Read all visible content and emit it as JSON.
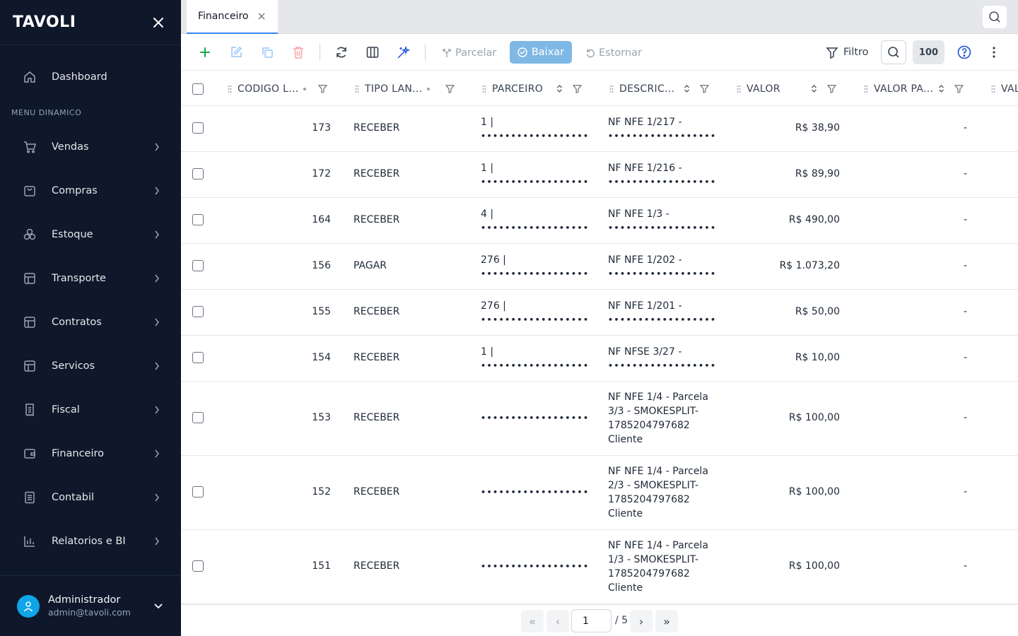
{
  "app": {
    "logo": "TAVOLI"
  },
  "sidebar": {
    "section_label": "MENU DINAMICO",
    "dashboard": {
      "label": "Dashboard",
      "icon": "home-icon"
    },
    "items": [
      {
        "label": "Vendas",
        "icon": "cart-icon"
      },
      {
        "label": "Compras",
        "icon": "shopping-bag-icon"
      },
      {
        "label": "Estoque",
        "icon": "boxes-icon"
      },
      {
        "label": "Transporte",
        "icon": "table-icon"
      },
      {
        "label": "Contratos",
        "icon": "table-icon"
      },
      {
        "label": "Servicos",
        "icon": "table-icon"
      },
      {
        "label": "Fiscal",
        "icon": "receipt-icon"
      },
      {
        "label": "Financeiro",
        "icon": "wallet-icon"
      },
      {
        "label": "Contabil",
        "icon": "ledger-icon"
      },
      {
        "label": "Relatorios e BI",
        "icon": "bar-chart-icon"
      }
    ],
    "user": {
      "name": "Administrador",
      "email": "admin@tavoli.com"
    }
  },
  "tabs": [
    {
      "label": "Financeiro",
      "active": true
    }
  ],
  "toolbar": {
    "parcelar_label": "Parcelar",
    "baixar_label": "Baixar",
    "estornar_label": "Estornar",
    "filtro_label": "Filtro",
    "page_size": "100",
    "accent_color": "#7fb8e4"
  },
  "table": {
    "columns": [
      "CODIGO L...",
      "TIPO LAN...",
      "PARCEIRO",
      "DESCRIC...",
      "VALOR",
      "VALOR PA...",
      "VAL"
    ],
    "rows": [
      {
        "codigo": "173",
        "tipo": "RECEBER",
        "parceiro_line1": "1 |",
        "parceiro_masked": "••••••••••••••••••",
        "descricao_lines": [
          "NF NFE 1/217 -",
          "••••••••••••••••••"
        ],
        "valor": "R$ 38,90",
        "valor_pago": "-"
      },
      {
        "codigo": "172",
        "tipo": "RECEBER",
        "parceiro_line1": "1 |",
        "parceiro_masked": "••••••••••••••••••",
        "descricao_lines": [
          "NF NFE 1/216 -",
          "••••••••••••••••••"
        ],
        "valor": "R$ 89,90",
        "valor_pago": "-"
      },
      {
        "codigo": "164",
        "tipo": "RECEBER",
        "parceiro_line1": "4 |",
        "parceiro_masked": "••••••••••••••••••",
        "descricao_lines": [
          "NF NFE 1/3 -",
          "••••••••••••••••••"
        ],
        "valor": "R$ 490,00",
        "valor_pago": "-"
      },
      {
        "codigo": "156",
        "tipo": "PAGAR",
        "parceiro_line1": "276 |",
        "parceiro_masked": "••••••••••••••••••",
        "descricao_lines": [
          "NF NFE 1/202 -",
          "••••••••••••••••••"
        ],
        "valor": "R$ 1.073,20",
        "valor_pago": "-"
      },
      {
        "codigo": "155",
        "tipo": "RECEBER",
        "parceiro_line1": "276 |",
        "parceiro_masked": "••••••••••••••••••",
        "descricao_lines": [
          "NF NFE 1/201 -",
          "••••••••••••••••••"
        ],
        "valor": "R$ 50,00",
        "valor_pago": "-"
      },
      {
        "codigo": "154",
        "tipo": "RECEBER",
        "parceiro_line1": "1 |",
        "parceiro_masked": "••••••••••••••••••",
        "descricao_lines": [
          "NF NFSE 3/27 -",
          "••••••••••••••••••"
        ],
        "valor": "R$ 10,00",
        "valor_pago": "-"
      },
      {
        "codigo": "153",
        "tipo": "RECEBER",
        "parceiro_line1": "",
        "parceiro_masked": "••••••••••••••••••",
        "descricao_lines": [
          "NF NFE 1/4 - Parcela",
          "3/3 - SMOKESPLIT-",
          "1785204797682",
          "Cliente"
        ],
        "valor": "R$ 100,00",
        "valor_pago": "-"
      },
      {
        "codigo": "152",
        "tipo": "RECEBER",
        "parceiro_line1": "",
        "parceiro_masked": "••••••••••••••••••",
        "descricao_lines": [
          "NF NFE 1/4 - Parcela",
          "2/3 - SMOKESPLIT-",
          "1785204797682",
          "Cliente"
        ],
        "valor": "R$ 100,00",
        "valor_pago": "-"
      },
      {
        "codigo": "151",
        "tipo": "RECEBER",
        "parceiro_line1": "",
        "parceiro_masked": "••••••••••••••••••",
        "descricao_lines": [
          "NF NFE 1/4 - Parcela",
          "1/3 - SMOKESPLIT-",
          "1785204797682",
          "Cliente"
        ],
        "valor": "R$ 100,00",
        "valor_pago": "-"
      }
    ]
  },
  "pagination": {
    "first": "«",
    "prev": "‹",
    "current_page": "1",
    "total_label": "/ 5",
    "next": "›",
    "last": "»"
  }
}
